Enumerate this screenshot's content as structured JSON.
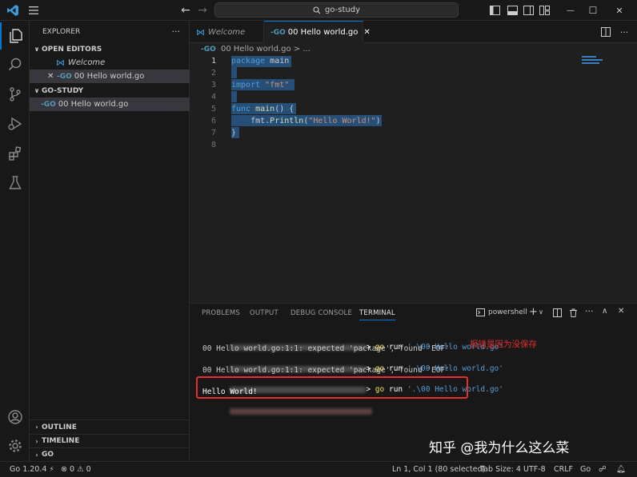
{
  "titlebar": {
    "search_text": "go-study",
    "minimize_glyph": "—",
    "maximize_glyph": "☐",
    "close_glyph": "✕"
  },
  "sidebar": {
    "title": "EXPLORER",
    "more": "···",
    "open_editors_label": "OPEN EDITORS",
    "open_editors": [
      {
        "name": "Welcome",
        "icon": "vscode-icon"
      },
      {
        "name": "00 Hello world.go",
        "icon": "go-file-icon"
      }
    ],
    "folder_label": "GO-STUDY",
    "files": [
      {
        "name": "00 Hello world.go",
        "icon": "go-file-icon"
      }
    ],
    "bottom_sections": [
      "OUTLINE",
      "TIMELINE",
      "GO"
    ]
  },
  "tabs": [
    {
      "label": "Welcome",
      "italic": true,
      "active": false
    },
    {
      "label": "00 Hello world.go",
      "active": true
    }
  ],
  "editor": {
    "breadcrumb": "00 Hello world.go > ...",
    "lines": [
      {
        "num": "1",
        "text": "package main"
      },
      {
        "num": "2",
        "text": ""
      },
      {
        "num": "3",
        "text": "import \"fmt\""
      },
      {
        "num": "4",
        "text": ""
      },
      {
        "num": "5",
        "text": "func main() {"
      },
      {
        "num": "6",
        "text": "    fmt.Println(\"Hello World!\")"
      },
      {
        "num": "7",
        "text": "}"
      },
      {
        "num": "8",
        "text": ""
      }
    ]
  },
  "panel": {
    "tabs": [
      "PROBLEMS",
      "OUTPUT",
      "DEBUG CONSOLE",
      "TERMINAL"
    ],
    "active_tab": "TERMINAL",
    "shell_label": "powershell",
    "terminal": {
      "cmd1": "go run '.\\00 Hello world.go'",
      "err1": "00 Hello world.go:1:1: expected 'package', found 'EOF'",
      "cmd2": "go run '.\\00 Hello world.go'",
      "err2": "00 Hello world.go:1:1: expected 'package', found 'EOF'",
      "cmd3": "go run '.\\00 Hello world.go'",
      "output": "Hello World!",
      "annotation": "报错是因为没保存"
    }
  },
  "watermark": "知乎 @我为什么这么菜",
  "statusbar": {
    "go_version": "Go 1.20.4",
    "errors": "0",
    "warnings": "0",
    "position": "Ln 1, Col 1 (80 selected)",
    "tab_size": "Tab Size: 4",
    "encoding": "UTF-8",
    "eol": "CRLF",
    "language": "Go"
  },
  "colors": {
    "accent": "#0078d4",
    "keyword": "#569cd6",
    "string": "#ce9178",
    "function": "#dcdcaa",
    "annotation_red": "#e03030",
    "selection": "#264f78"
  }
}
